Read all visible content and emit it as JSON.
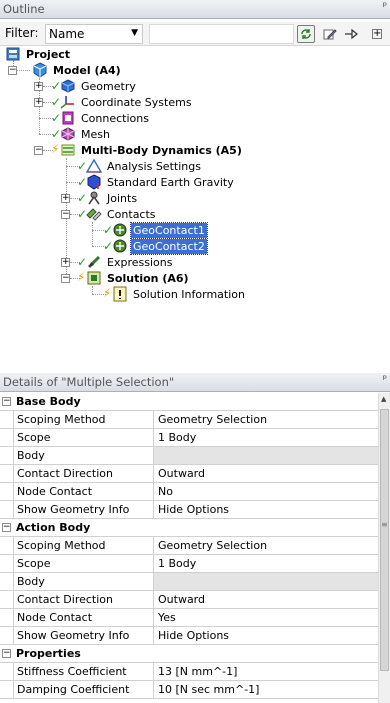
{
  "outline": {
    "title": "Outline",
    "pin": "ᵖ",
    "filter_label": "Filter:",
    "filter_value": "Name",
    "tree": [
      {
        "label": "Project"
      },
      {
        "label": "Model (A4)"
      },
      {
        "label": "Geometry"
      },
      {
        "label": "Coordinate Systems"
      },
      {
        "label": "Connections"
      },
      {
        "label": "Mesh"
      },
      {
        "label": "Multi-Body Dynamics (A5)"
      },
      {
        "label": "Analysis Settings"
      },
      {
        "label": "Standard Earth Gravity"
      },
      {
        "label": "Joints"
      },
      {
        "label": "Contacts"
      },
      {
        "label": "GeoContact1"
      },
      {
        "label": "GeoContact2"
      },
      {
        "label": "Expressions"
      },
      {
        "label": "Solution (A6)"
      },
      {
        "label": "Solution Information"
      }
    ]
  },
  "details": {
    "title": "Details of \"Multiple Selection\"",
    "pin": "ᵖ",
    "rows": [
      {
        "group": "Base Body"
      },
      {
        "name": "Scoping Method",
        "value": "Geometry Selection"
      },
      {
        "name": "Scope",
        "value": "1 Body"
      },
      {
        "name": "Body",
        "value": ""
      },
      {
        "name": "Contact Direction",
        "value": "Outward"
      },
      {
        "name": "Node Contact",
        "value": "No"
      },
      {
        "name": "Show Geometry Info",
        "value": "Hide Options"
      },
      {
        "group": "Action Body"
      },
      {
        "name": "Scoping Method",
        "value": "Geometry Selection"
      },
      {
        "name": "Scope",
        "value": "1 Body"
      },
      {
        "name": "Body",
        "value": ""
      },
      {
        "name": "Contact Direction",
        "value": "Outward"
      },
      {
        "name": "Node Contact",
        "value": "Yes"
      },
      {
        "name": "Show Geometry Info",
        "value": "Hide Options"
      },
      {
        "group": "Properties"
      },
      {
        "name": "Stiffness Coefficient",
        "value": "13 [N mm^-1]"
      },
      {
        "name": "Damping Coefficient",
        "value": "10 [N sec mm^-1]"
      }
    ]
  },
  "colors": {
    "selection": "#3b6fd4",
    "check": "#2a9a2a",
    "bolt": "#e8a400",
    "header": "#d9dde4"
  }
}
